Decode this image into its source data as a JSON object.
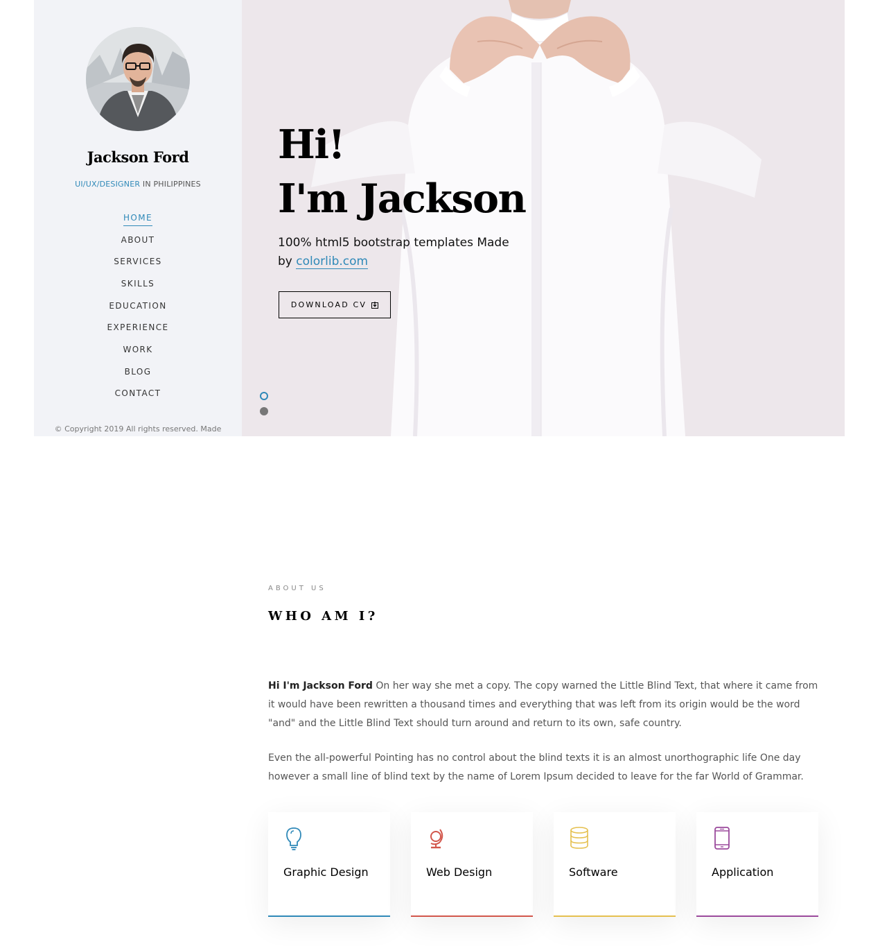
{
  "colors": {
    "accent": "#2f89b8",
    "graphic_design": "#2f89b8",
    "web_design": "#d2564b",
    "software": "#e5c04f",
    "application": "#9b4a9c"
  },
  "sidebar": {
    "name": "Jackson Ford",
    "role_accent": "UI/UX/DESIGNER",
    "role_rest": " IN PHILIPPINES",
    "nav": [
      {
        "label": "HOME",
        "active": true
      },
      {
        "label": "ABOUT",
        "active": false
      },
      {
        "label": "SERVICES",
        "active": false
      },
      {
        "label": "SKILLS",
        "active": false
      },
      {
        "label": "EDUCATION",
        "active": false
      },
      {
        "label": "EXPERIENCE",
        "active": false
      },
      {
        "label": "WORK",
        "active": false
      },
      {
        "label": "BLOG",
        "active": false
      },
      {
        "label": "CONTACT",
        "active": false
      }
    ],
    "copyright": "© Copyright 2019 All rights reserved. Made"
  },
  "hero": {
    "title_line1": "Hi!",
    "title_line2": "I'm Jackson",
    "sub_text": "100% html5 bootstrap templates Made by ",
    "sub_link": "colorlib.com",
    "cv_button": "DOWNLOAD CV",
    "cv_icon": "download-icon",
    "slides": 2,
    "active_slide": 1
  },
  "about": {
    "kicker": "ABOUT US",
    "heading": "WHO AM I?",
    "p1_bold": "Hi I'm Jackson Ford",
    "p1_rest": " On her way she met a copy. The copy warned the Little Blind Text, that where it came from it would have been rewritten a thousand times and everything that was left from its origin would be the word \"and\" and the Little Blind Text should turn around and return to its own, safe country.",
    "p2": "Even the all-powerful Pointing has no control about the blind texts it is an almost unorthographic life One day however a small line of blind text by the name of Lorem Ipsum decided to leave for the far World of Grammar.",
    "cards": [
      {
        "label": "Graphic Design",
        "icon": "lightbulb-icon"
      },
      {
        "label": "Web Design",
        "icon": "globe-icon"
      },
      {
        "label": "Software",
        "icon": "database-icon"
      },
      {
        "label": "Application",
        "icon": "mobile-icon"
      }
    ]
  }
}
